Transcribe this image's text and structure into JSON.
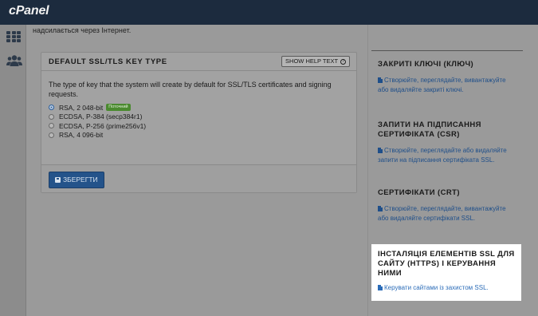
{
  "app": {
    "logo": "cPanel"
  },
  "sidebar": {
    "icons": [
      "grid-icon",
      "users-icon"
    ]
  },
  "main": {
    "top_text": "надсилається через Інтернет."
  },
  "panel": {
    "title": "DEFAULT SSL/TLS KEY TYPE",
    "help_label": "SHOW HELP TEXT",
    "description": "The type of key that the system will create by default for SSL/TLS certificates and signing requests.",
    "options": [
      {
        "label": "RSA, 2 048-bit",
        "selected": true,
        "badge": "Поточний"
      },
      {
        "label": "ECDSA, P-384 (secp384r1)",
        "selected": false
      },
      {
        "label": "ECDSA, P-256 (prime256v1)",
        "selected": false
      },
      {
        "label": "RSA, 4 096-bit",
        "selected": false
      }
    ],
    "save_label": "ЗБЕРЕГТИ"
  },
  "right": {
    "sections": [
      {
        "title": "ЗАКРИТІ КЛЮЧІ (КЛЮЧ)",
        "link": "Створюйте, переглядайте, вивантажуйте або видаляйте закриті ключі."
      },
      {
        "title": "ЗАПИТИ НА ПІДПИСАННЯ СЕРТИФІКАТА (CSR)",
        "link": "Створюйте, переглядайте або видаляйте запити на підписання сертифіката SSL."
      },
      {
        "title": "СЕРТИФІКАТИ (CRT)",
        "link": "Створюйте, переглядайте, вивантажуйте або видаляйте сертифікати SSL."
      },
      {
        "title": "ІНСТАЛЯЦІЯ ЕЛЕМЕНТІВ SSL ДЛЯ САЙТУ (HTTPS) І КЕРУВАННЯ НИМИ",
        "link": "Керувати сайтами із захистом SSL."
      }
    ]
  },
  "colors": {
    "topbar": "#1c2b3e",
    "accent": "#2c5f9c",
    "badge": "#4a8a2f",
    "link": "#1f4f8a"
  }
}
